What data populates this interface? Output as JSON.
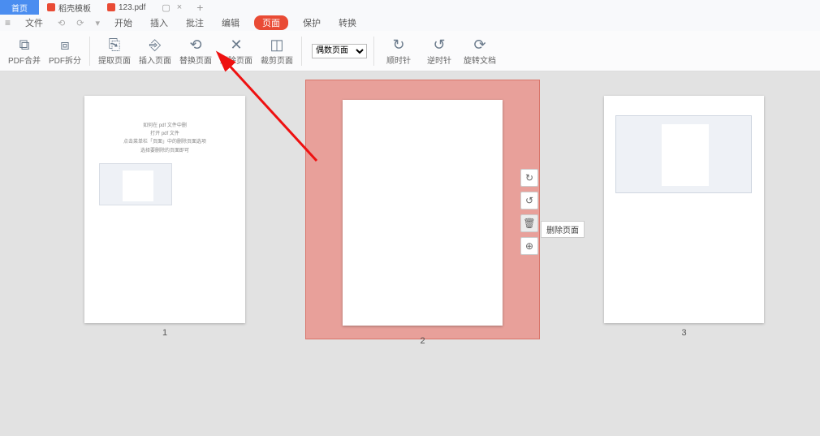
{
  "titlebar": {
    "tabs": [
      {
        "label": "首页",
        "kind": "home"
      },
      {
        "label": "稻壳模板",
        "kind": "template"
      },
      {
        "label": "123.pdf",
        "kind": "file"
      }
    ],
    "plus": "+"
  },
  "menubar": {
    "file_icon": "≡",
    "file": "文件",
    "items": [
      "开始",
      "插入",
      "批注",
      "编辑",
      "页面",
      "保护",
      "转换"
    ],
    "active_index": 4
  },
  "toolbar": {
    "merge": "PDF合并",
    "split": "PDF拆分",
    "extract": "提取页面",
    "insert": "插入页面",
    "replace": "替换页面",
    "delete": "删除页面",
    "crop": "裁剪页面",
    "select_value": "偶数页面",
    "cw": "顺时针",
    "ccw": "逆时针",
    "rotate_doc": "旋转文档"
  },
  "thumbs": {
    "page1": {
      "num": "1",
      "lines": [
        "如何在 pdf 文件中删",
        "打开 pdf 文件",
        "点击菜单栏「页面」中的删除页面选项",
        "选择要删除的页面即可"
      ]
    },
    "page2": {
      "num": "2"
    },
    "page3": {
      "num": "3"
    }
  },
  "floating": {
    "rotate_cw": "↻",
    "rotate_ccw": "↺",
    "delete": "🗑",
    "add": "⊕",
    "tooltip": "删除页面"
  },
  "colors": {
    "accent_red": "#e94b35",
    "accent_blue": "#4a8df0",
    "select_bg": "#e8a09a"
  }
}
